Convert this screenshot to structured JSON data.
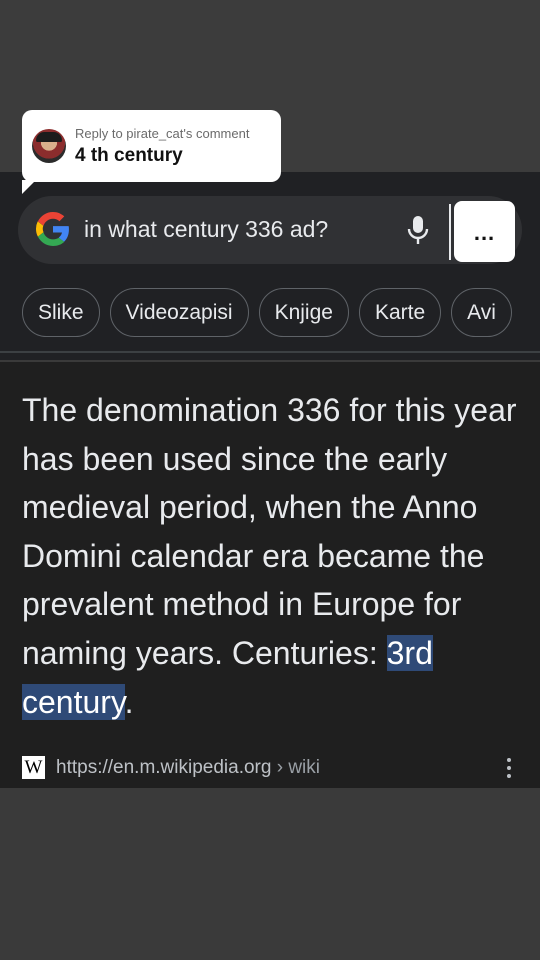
{
  "reply_bubble": {
    "caption": "Reply to pirate_cat's comment",
    "comment": "4 th century"
  },
  "search": {
    "query": "in what century 336 ad?",
    "more_label": "..."
  },
  "chips": [
    "Slike",
    "Videozapisi",
    "Knjige",
    "Karte",
    "Avi"
  ],
  "result": {
    "text_before": "The denomination 336 for this year has been used since the early medieval period, when the Anno Domini calendar era became the prevalent method in Europe for naming years. Centuries: ",
    "highlight": "3rd century",
    "text_after": ".",
    "source_url": "https://en.m.wikipedia.org",
    "source_crumb": " › wiki",
    "source_icon": "W"
  },
  "colors": {
    "search_panel_bg": "#202124",
    "highlight_bg": "#2f4a77",
    "text": "#e8eaed"
  }
}
